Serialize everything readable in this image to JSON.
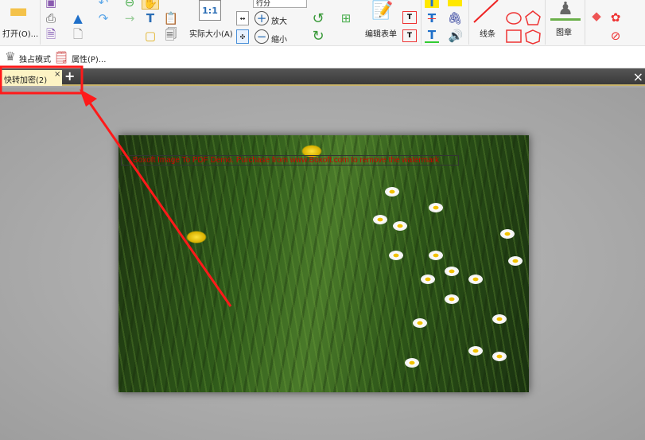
{
  "toolbar": {
    "open_label": "打开(O)...",
    "actual_size_label": "实际大小(A)",
    "actual_size_icon_text": "1:1",
    "zoom_value": "行分",
    "zoom_in_label": "放大",
    "zoom_out_label": "缩小",
    "edit_form_label": "编辑表单",
    "lines_label": "线条",
    "stamp_label": "图章"
  },
  "row2": {
    "exclusive_mode_label": "独占模式",
    "properties_label": "属性(P)..."
  },
  "tabs": [
    {
      "label": "快转加密(2)",
      "close": "×"
    }
  ],
  "tab_add": "+",
  "window_close": "×",
  "document": {
    "watermark": "Boxoft Image To PDF Demo. Purchase from www.Boxoft.com to remove the watermark"
  },
  "annotation_color": "#ff1a1a"
}
